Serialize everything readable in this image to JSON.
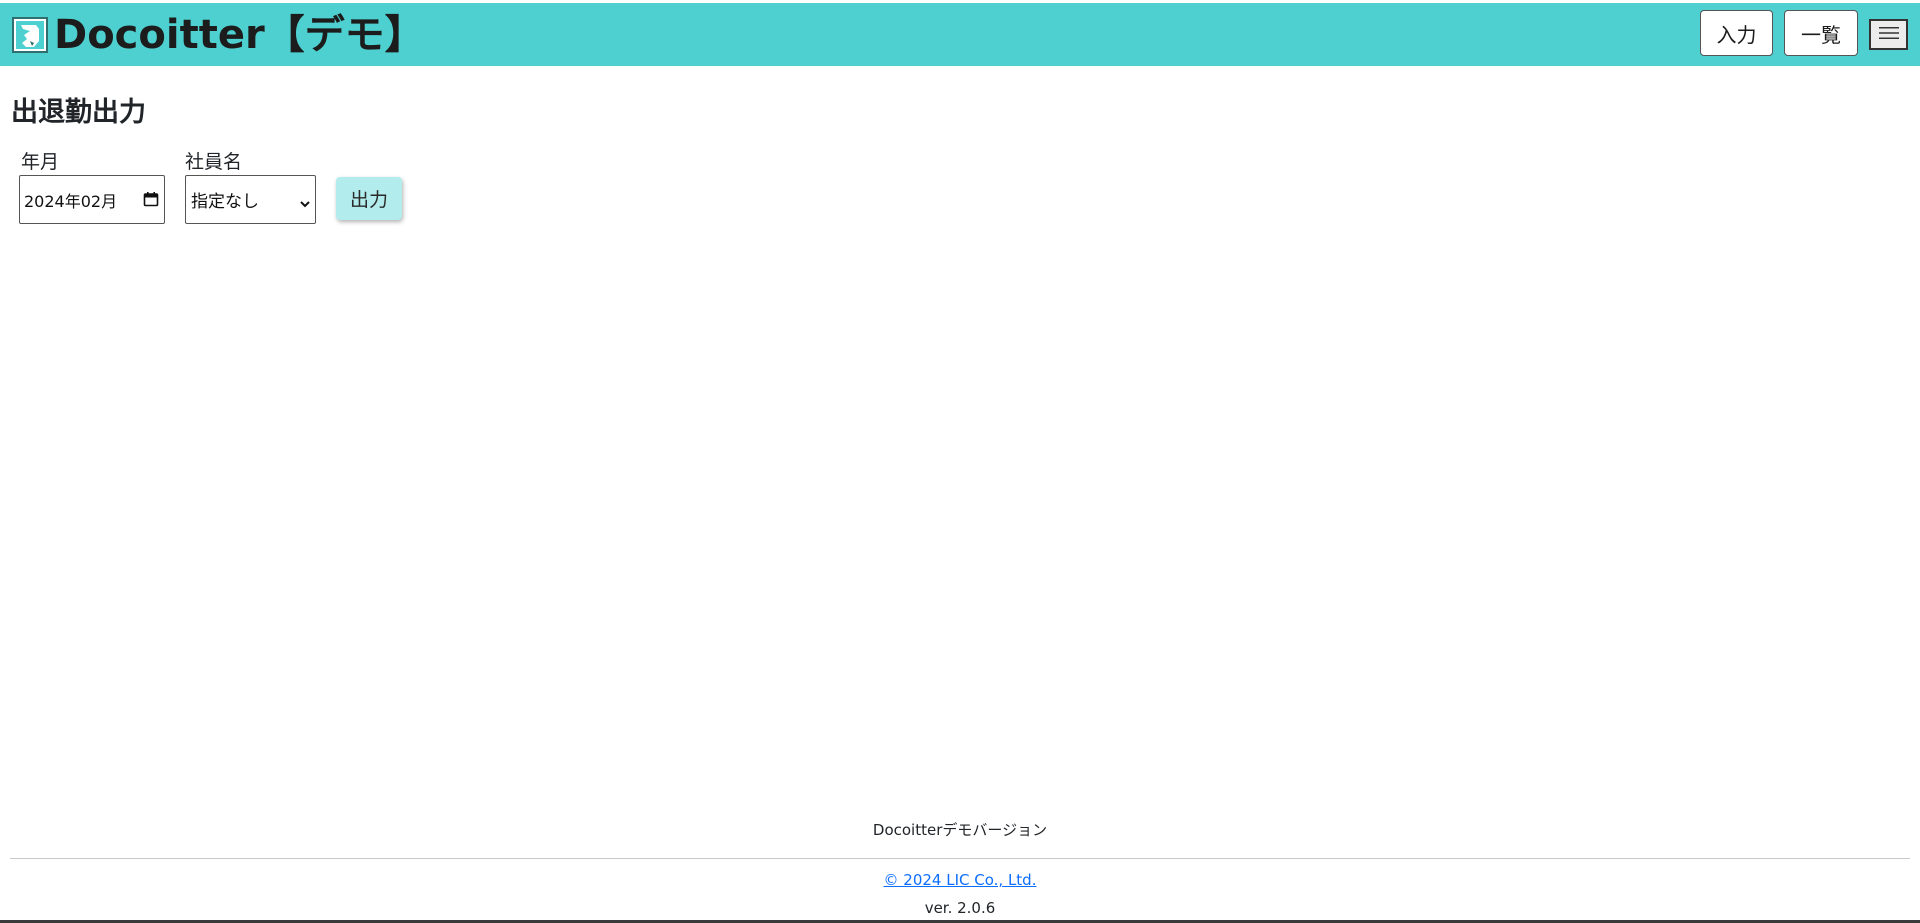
{
  "header": {
    "title": "Docoitter【デモ】",
    "logo_icon": "docoitter-logo-icon",
    "nav": {
      "input_label": "入力",
      "list_label": "一覧"
    },
    "menu_icon": "hamburger-menu-icon"
  },
  "main": {
    "title": "出退勤出力",
    "form": {
      "month_label": "年月",
      "month_value": "2024年02月",
      "employee_label": "社員名",
      "employee_value": "指定なし",
      "output_button_label": "出力"
    }
  },
  "footer": {
    "subtitle": "Docoitterデモバージョン",
    "copyright": "© 2024 LIC Co., Ltd.",
    "version": "ver. 2.0.6"
  },
  "colors": {
    "header_bg": "#4dd0cf",
    "button_bg": "#b2ecec",
    "link": "#0d6efd"
  }
}
